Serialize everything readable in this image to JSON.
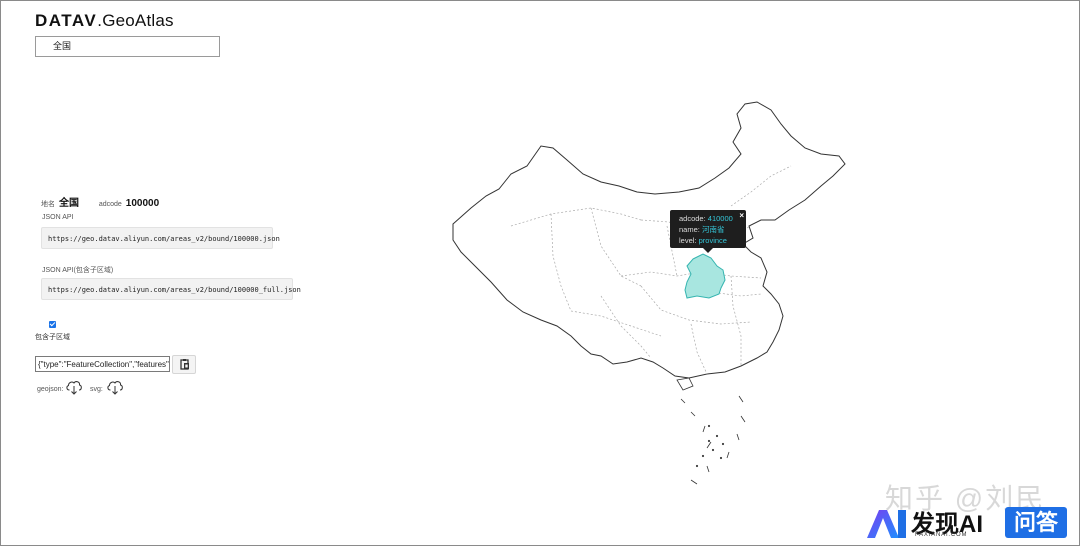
{
  "brand": {
    "bold": "DATAV",
    "rest": ".GeoAtlas"
  },
  "region_select": {
    "value": "全国"
  },
  "info": {
    "region_label": "地名",
    "region_value": "全国",
    "adcode_label": "adcode",
    "adcode_value": "100000"
  },
  "json_api": {
    "label": "JSON API",
    "url": "https://geo.datav.aliyun.com/areas_v2/bound/100000.json"
  },
  "json_api_full": {
    "label": "JSON API(包含子区域)",
    "url": "https://geo.datav.aliyun.com/areas_v2/bound/100000_full.json"
  },
  "include_sub": {
    "label": "包含子区域",
    "checked": true
  },
  "geojson_input": {
    "value": "{\"type\":\"FeatureCollection\",\"features\":"
  },
  "downloads": {
    "geojson_label": "geojson:",
    "svg_label": "svg:"
  },
  "icons": {
    "copy": "clipboard-icon",
    "download": "cloud-download-icon",
    "close": "close-icon"
  },
  "tooltip": {
    "adcode_label": "adcode:",
    "adcode_value": "410000",
    "name_label": "name:",
    "name_value": "河南省",
    "level_label": "level:",
    "level_value": "province",
    "close": "×"
  },
  "watermark": {
    "text": "知乎 @刘民"
  },
  "badge": {
    "main": "发现AI",
    "sub": "FAXIANAI.COM",
    "qa": "问答"
  },
  "colors": {
    "accent_blue": "#1a73e8",
    "highlight_fill": "#a8e6e0",
    "highlight_stroke": "#35b5b0",
    "tooltip_value": "#35c6d8",
    "qa_blue": "#1f6fe5"
  }
}
